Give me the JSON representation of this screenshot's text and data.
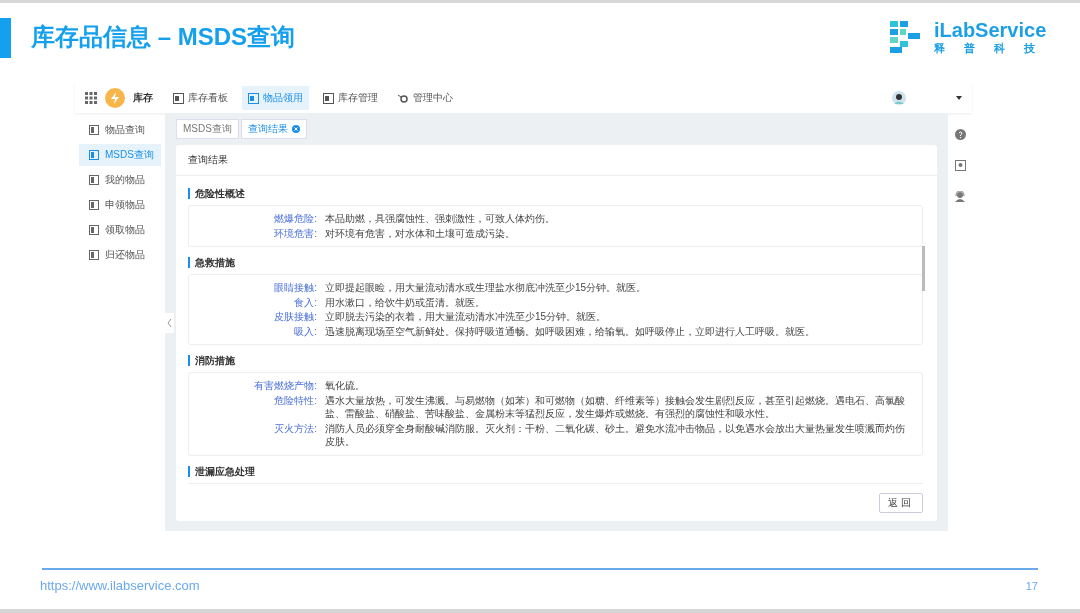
{
  "slide": {
    "title": "库存品信息 – MSDS查询",
    "logo_name": "iLabService",
    "logo_subtitle": "释普科技"
  },
  "app": {
    "brand": "库存",
    "nav": [
      {
        "label": "库存看板",
        "selected": false
      },
      {
        "label": "物品领用",
        "selected": true
      },
      {
        "label": "库存管理",
        "selected": false
      },
      {
        "label": "管理中心",
        "selected": false
      }
    ],
    "sidebar": [
      {
        "label": "物品查询",
        "selected": false
      },
      {
        "label": "MSDS查询",
        "selected": true
      },
      {
        "label": "我的物品",
        "selected": false
      },
      {
        "label": "申领物品",
        "selected": false
      },
      {
        "label": "领取物品",
        "selected": false
      },
      {
        "label": "归还物品",
        "selected": false
      }
    ],
    "breadcrumbs": [
      {
        "label": "MSDS查询",
        "selected": false
      },
      {
        "label": "查询结果",
        "selected": true
      }
    ],
    "card_title": "查询结果",
    "sections": [
      {
        "title": "危险性概述",
        "rows": [
          {
            "label": "燃爆危险:",
            "text": "本品助燃，具强腐蚀性、强刺激性，可致人体灼伤。"
          },
          {
            "label": "环境危害:",
            "text": "对环境有危害，对水体和土壤可造成污染。"
          }
        ]
      },
      {
        "title": "急救措施",
        "rows": [
          {
            "label": "眼睛接触:",
            "text": "立即提起眼睑，用大量流动清水或生理盐水彻底冲洗至少15分钟。就医。"
          },
          {
            "label": "食入:",
            "text": "用水漱口，给饮牛奶或蛋清。就医。"
          },
          {
            "label": "皮肤接触:",
            "text": "立即脱去污染的衣着，用大量流动清水冲洗至少15分钟。就医。"
          },
          {
            "label": "吸入:",
            "text": "迅速脱离现场至空气新鲜处。保持呼吸道通畅。如呼吸困难，给输氧。如呼吸停止，立即进行人工呼吸。就医。"
          }
        ]
      },
      {
        "title": "消防措施",
        "rows": [
          {
            "label": "有害燃烧产物:",
            "text": "氧化硫。"
          },
          {
            "label": "危险特性:",
            "text": "遇水大量放热，可发生沸溅。与易燃物（如苯）和可燃物（如糖、纤维素等）接触会发生剧烈反应，甚至引起燃烧。遇电石、高氯酸盐、雷酸盐、硝酸盐、苦味酸盐、金属粉末等猛烈反应，发生爆炸或燃烧。有强烈的腐蚀性和吸水性。"
          },
          {
            "label": "灭火方法:",
            "text": "消防人员必须穿全身耐酸碱消防服。灭火剂：干粉、二氧化碳、砂土。避免水流冲击物品，以免遇水会放出大量热量发生喷溅而灼伤皮肤。"
          }
        ]
      },
      {
        "title": "泄漏应急处理"
      }
    ],
    "back_button": "返回"
  },
  "footer": {
    "url": "https://www.ilabservice.com",
    "page": "17"
  }
}
